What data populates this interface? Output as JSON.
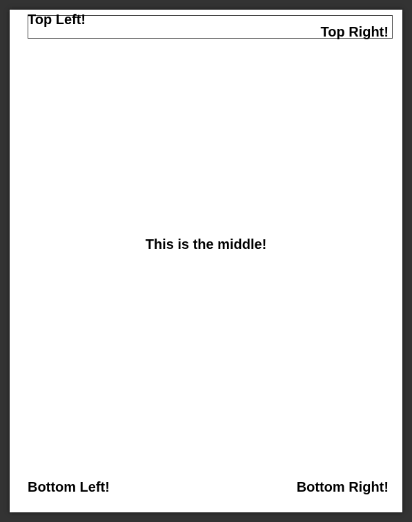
{
  "top_left": "Top Left!",
  "top_right": "Top Right!",
  "middle": "This is the middle!",
  "bottom_left": "Bottom Left!",
  "bottom_right": "Bottom Right!"
}
